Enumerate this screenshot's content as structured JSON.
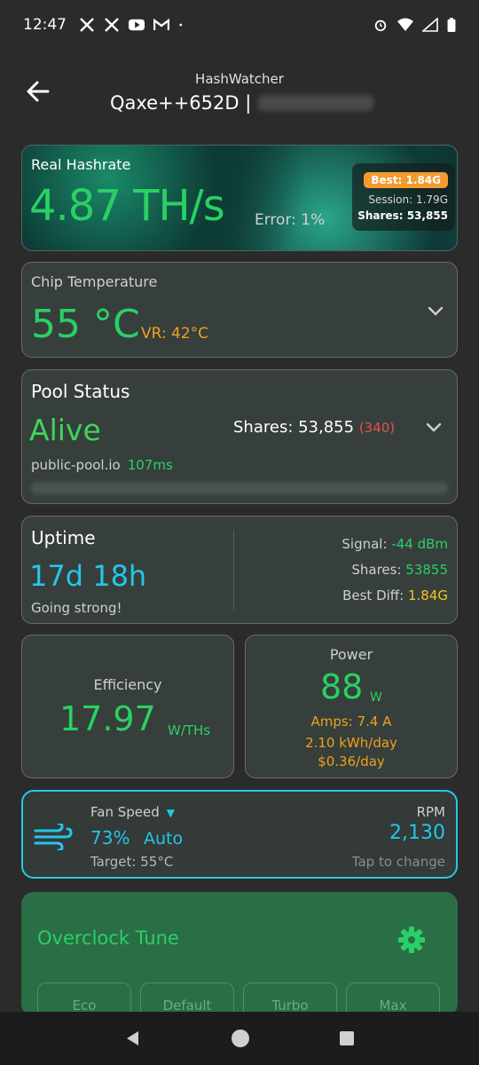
{
  "status_bar": {
    "time": "12:47",
    "notification_icons": [
      "x-icon",
      "x-icon",
      "youtube-icon",
      "gmail-icon",
      "dot-icon"
    ],
    "right_icons": [
      "alarm-icon",
      "wifi-icon",
      "signal-icon",
      "battery-icon"
    ]
  },
  "header": {
    "app_name": "HashWatcher",
    "device_name": "Qaxe++652D |"
  },
  "hashrate": {
    "label": "Real Hashrate",
    "value": "4.87 TH/s",
    "error": "Error: 1%",
    "best": "Best: 1.84G",
    "session": "Session: 1.79G",
    "shares": "Shares: 53,855"
  },
  "chip": {
    "label": "Chip Temperature",
    "value": "55 °C",
    "vr": "VR: 42°C"
  },
  "pool": {
    "title": "Pool Status",
    "status": "Alive",
    "shares_label": "Shares: 53,855",
    "rejected": "(340)",
    "url": "public-pool.io",
    "latency": "107ms"
  },
  "uptime": {
    "title": "Uptime",
    "value": "17d 18h",
    "sub": "Going strong!",
    "signal_label": "Signal:",
    "signal_value": "-44 dBm",
    "shares_label": "Shares:",
    "shares_value": "53855",
    "best_label": "Best Diff:",
    "best_value": "1.84G"
  },
  "efficiency": {
    "label": "Efficiency",
    "value": "17.97",
    "unit": "W/THs"
  },
  "power": {
    "label": "Power",
    "value": "88",
    "unit": "W",
    "amps": "Amps: 7.4 A",
    "kwh": "2.10 kWh/day",
    "cost": "$0.36/day"
  },
  "fan": {
    "label": "Fan Speed",
    "caret": "▼",
    "percent": "73%",
    "mode": "Auto",
    "target": "Target: 55°C",
    "rpm_label": "RPM",
    "rpm": "2,130",
    "hint": "Tap to change"
  },
  "overclock": {
    "title": "Overclock Tune",
    "tabs": [
      "Eco",
      "Default",
      "Turbo",
      "Max"
    ]
  },
  "colors": {
    "accent_green": "#2ad065",
    "accent_cyan": "#25c6e8",
    "accent_orange": "#f0a020",
    "card_bg": "#363f3b"
  }
}
